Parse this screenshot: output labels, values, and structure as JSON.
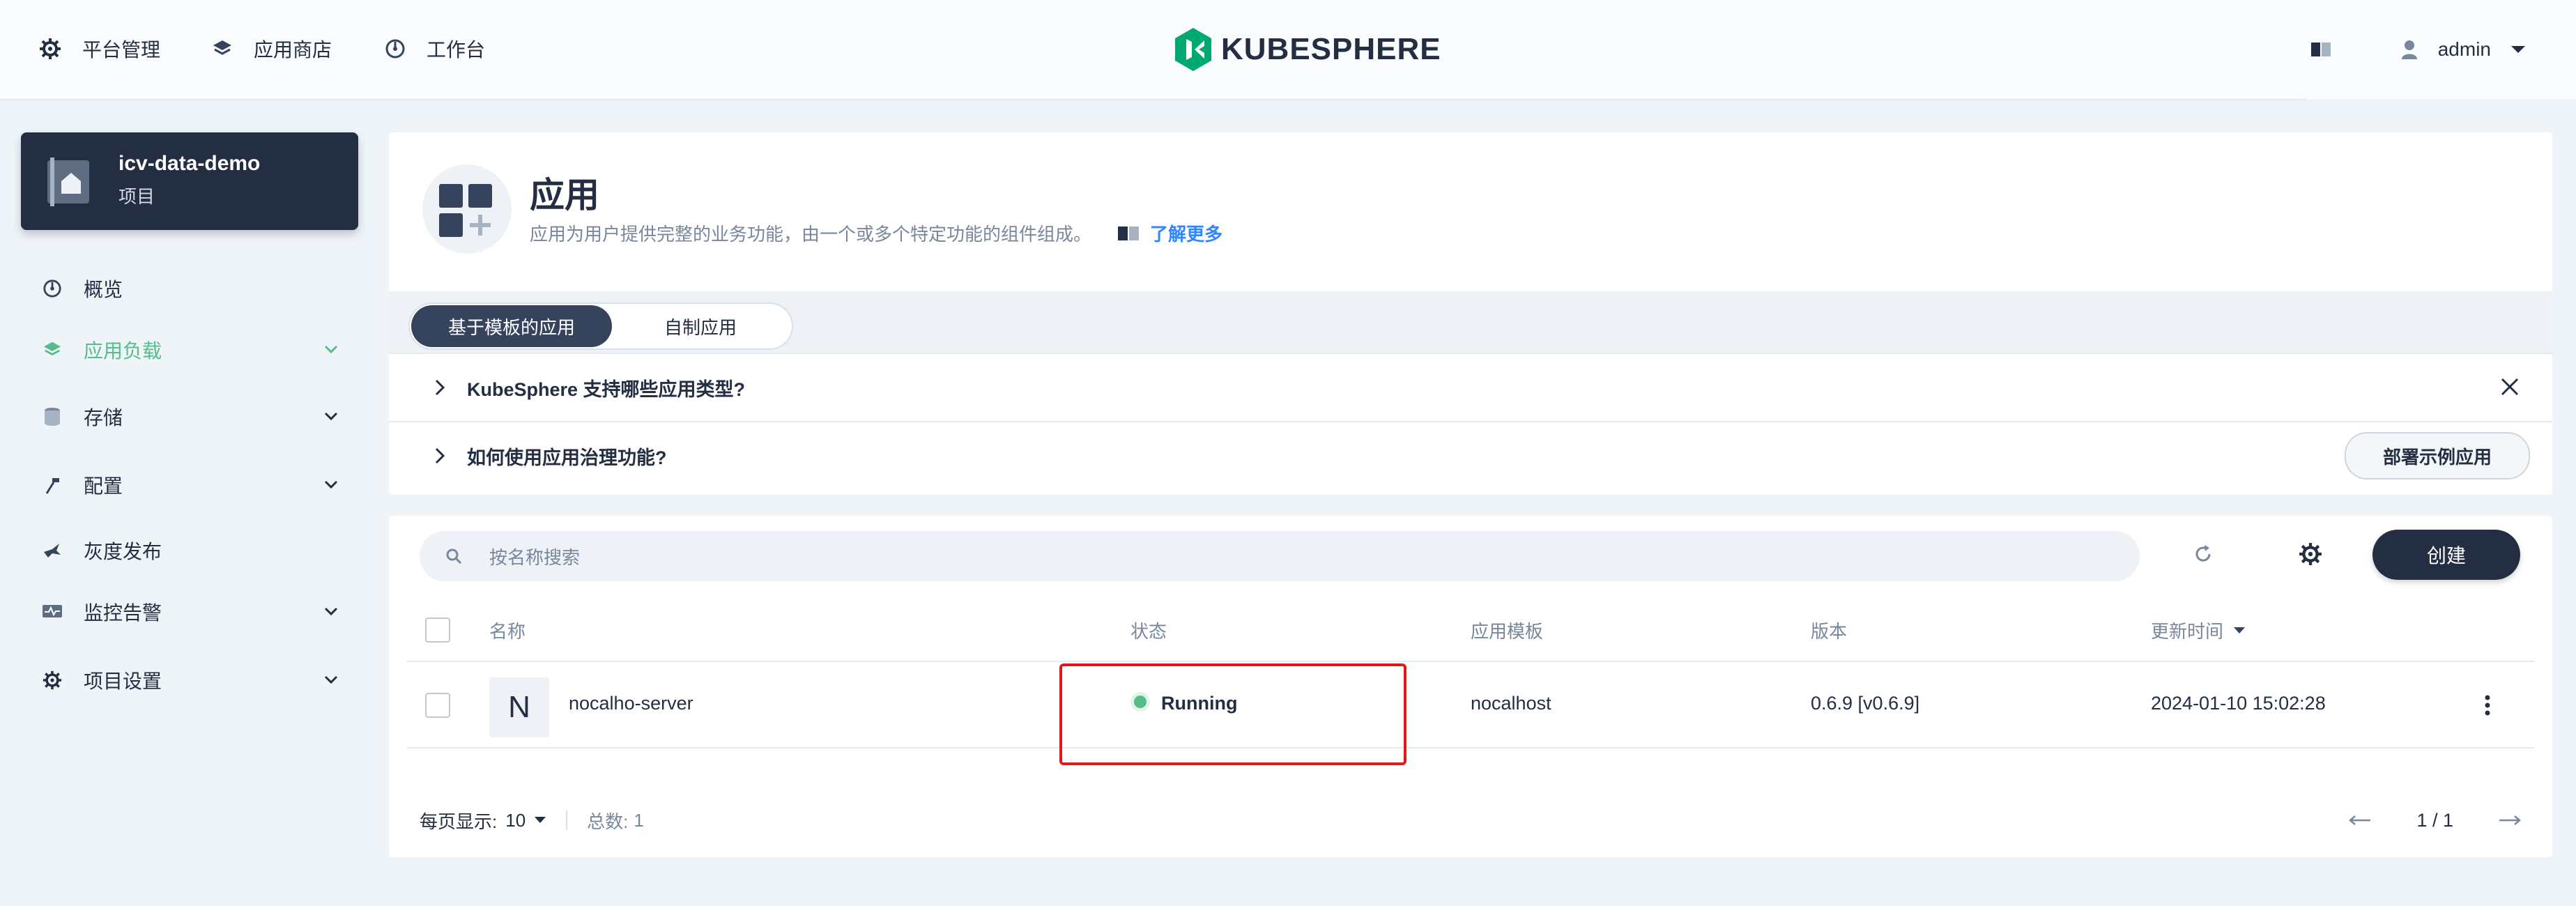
{
  "topnav": {
    "items": [
      {
        "label": "平台管理",
        "icon": "gear-icon"
      },
      {
        "label": "应用商店",
        "icon": "layers-icon"
      },
      {
        "label": "工作台",
        "icon": "dashboard-icon"
      }
    ],
    "logo_text": "KUBESPHERE",
    "user": "admin"
  },
  "project": {
    "name": "icv-data-demo",
    "type": "项目"
  },
  "sidebar": {
    "items": [
      {
        "label": "概览",
        "icon": "dashboard-icon",
        "expandable": false,
        "active": false
      },
      {
        "label": "应用负载",
        "icon": "layers-icon",
        "expandable": true,
        "active": true
      },
      {
        "label": "存储",
        "icon": "database-icon",
        "expandable": true,
        "active": false
      },
      {
        "label": "配置",
        "icon": "hammer-icon",
        "expandable": true,
        "active": false
      },
      {
        "label": "灰度发布",
        "icon": "bird-icon",
        "expandable": false,
        "active": false
      },
      {
        "label": "监控告警",
        "icon": "monitor-icon",
        "expandable": true,
        "active": false
      },
      {
        "label": "项目设置",
        "icon": "gear-icon",
        "expandable": true,
        "active": false
      }
    ]
  },
  "banner": {
    "title": "应用",
    "description": "应用为用户提供完整的业务功能，由一个或多个特定功能的组件组成。",
    "learn_more": "了解更多"
  },
  "tabs": {
    "active": "基于模板的应用",
    "inactive": "自制应用"
  },
  "faq": {
    "q1": "KubeSphere 支持哪些应用类型?",
    "q2": "如何使用应用治理功能?",
    "deploy_demo": "部署示例应用"
  },
  "toolbar": {
    "search_placeholder": "按名称搜索",
    "create_label": "创建"
  },
  "table": {
    "columns": [
      "名称",
      "状态",
      "应用模板",
      "版本",
      "更新时间"
    ],
    "rows": [
      {
        "avatar": "N",
        "name": "nocalho-server",
        "status": "Running",
        "template": "nocalhost",
        "version": "0.6.9 [v0.6.9]",
        "updated": "2024-01-10 15:02:28"
      }
    ]
  },
  "footer": {
    "page_size_label": "每页显示:",
    "page_size": "10",
    "total_label": "总数:",
    "total": "1",
    "page": "1 / 1"
  },
  "colors": {
    "accent_green": "#55bc8a",
    "dark": "#242e42",
    "highlight_red": "#e0171b"
  }
}
